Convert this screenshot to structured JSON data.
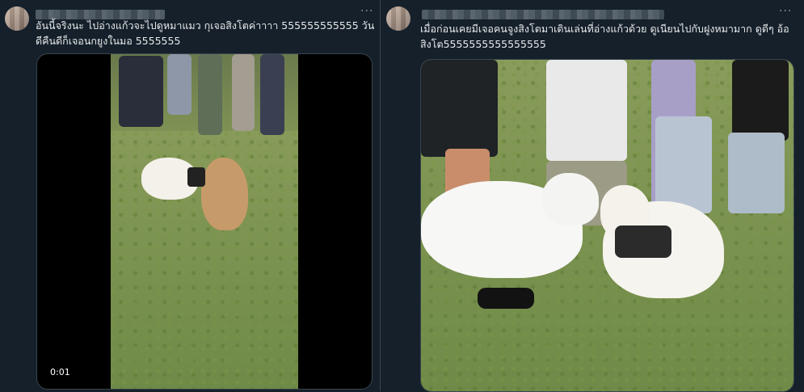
{
  "posts": [
    {
      "more_label": "···",
      "text": "อันนี้จริงนะ ไปอ่างแก้วจะไปดูหมาแมว กุเจอสิงโตค่าาาา 555555555555 วันดีคืนดีก็เจอนกยูงในมอ 5555555",
      "video_time": "0:01"
    },
    {
      "more_label": "···",
      "text": "เมื่อก่อนเคยมีเจอคนจูงสิงโตมาเดินเล่นที่อ่างแก้วด้วย ดูเนียนไปกับฝูงหมามาก ดูดีๆ อ้อสิงโต5555555555555555"
    }
  ],
  "colors": {
    "background": "#15202b",
    "text": "#e7e9ea",
    "muted": "#8b98a5",
    "border": "#38444d"
  }
}
